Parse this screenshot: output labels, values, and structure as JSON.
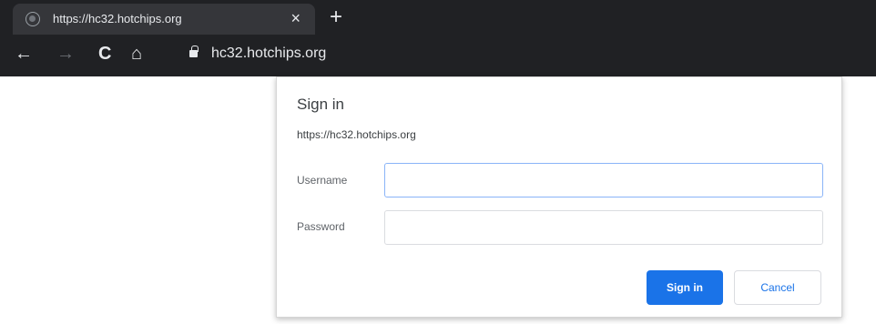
{
  "browser": {
    "tab": {
      "title": "https://hc32.hotchips.org",
      "close_glyph": "×",
      "favicon": "globe-icon"
    },
    "new_tab_glyph": "+",
    "nav": {
      "back_glyph": "←",
      "forward_glyph": "→",
      "reload_glyph": "C",
      "home_glyph": "⌂"
    },
    "address": {
      "url": "hc32.hotchips.org",
      "secure_icon": "lock-icon"
    },
    "colors": {
      "chrome_dark": "#202124",
      "tab_active": "#35363a",
      "text_light": "#e8eaed"
    }
  },
  "dialog": {
    "title": "Sign in",
    "origin": "https://hc32.hotchips.org",
    "username_label": "Username",
    "username_value": "",
    "password_label": "Password",
    "password_value": "",
    "sign_in_label": "Sign in",
    "cancel_label": "Cancel",
    "accent_color": "#1a73e8"
  }
}
